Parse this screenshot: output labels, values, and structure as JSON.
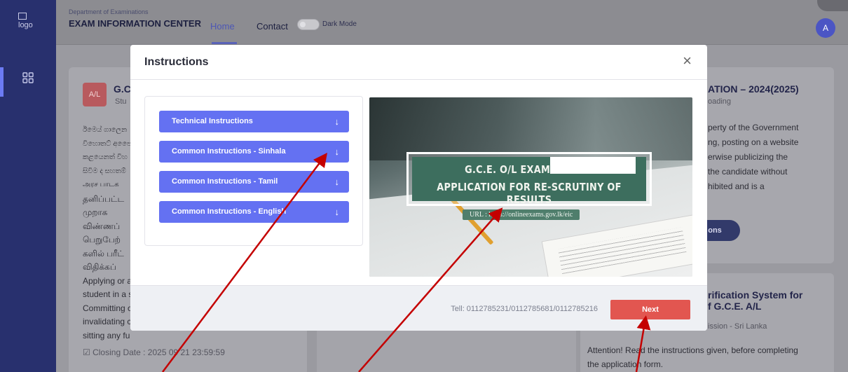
{
  "sidebar": {
    "logo_alt": "logo"
  },
  "header": {
    "department": "Department of Examinations",
    "center_name": "EXAM INFORMATION CENTER",
    "nav": {
      "home": "Home",
      "contact": "Contact"
    },
    "dark_mode_label": "Dark Mode",
    "avatar_initial": "A"
  },
  "background": {
    "left_card": {
      "badge": "A/L",
      "title_fragment": "G.C",
      "subtitle_fragment": "Stu",
      "lines": [
        "ඊමෙය් ගාලෙන",
        "විහොතට් අපෙෙ",
        "කළයෙනත් විහ",
        "සිවිම ද සහතම්",
        "அரச பாடக",
        "தனிப்பட்ட",
        "முறாக",
        "விண்ணப்",
        "பெறுபேற்",
        "களில் பரீட்",
        "விதிக்கப்",
        "Applying or a",
        "student in a s",
        "Committing c",
        "invalidating c",
        "sitting any fu"
      ],
      "closing": "Closing Date : 2025 09 21 23:59:59"
    },
    "right_card": {
      "title_fragment": "ATION – 2024(2025)",
      "status_fragment": "oading",
      "lines": [
        "perty of the Government",
        "ng, posting on a website",
        "erwise publicizing the",
        "the candidate without",
        "hibited and is a"
      ],
      "button_fragment": "ons"
    },
    "right_card2": {
      "title_lines": [
        "rification System for",
        "f G.C.E. A/L"
      ],
      "sub_fragment": "ission - Sri Lanka",
      "attention": [
        "Attention! Read the instructions given, before completing",
        "the application form."
      ]
    }
  },
  "modal": {
    "title": "Instructions",
    "close_symbol": "×",
    "accordion": [
      {
        "label": "Technical Instructions",
        "arrow": "↓"
      },
      {
        "label": "Common Instructions - Sinhala",
        "arrow": "↓"
      },
      {
        "label": "Common Instructions - Tamil",
        "arrow": "↓"
      },
      {
        "label": "Common Instructions - English",
        "arrow": "↓"
      }
    ],
    "banner": {
      "line1": "G.C.E. O/L EXAMINATION",
      "line2": "APPLICATION FOR RE-SCRUTINY OF RESULTS",
      "url": "URL : https://onlineexams.gov.lk/eic"
    },
    "footer": {
      "tel": "Tell: 0112785231/0112785681/0112785216",
      "next_label": "Next"
    }
  },
  "colors": {
    "accordion": "#6471f2",
    "next_button": "#e25650",
    "annotation_arrows": "#c40000",
    "sidebar": "#28306e"
  }
}
